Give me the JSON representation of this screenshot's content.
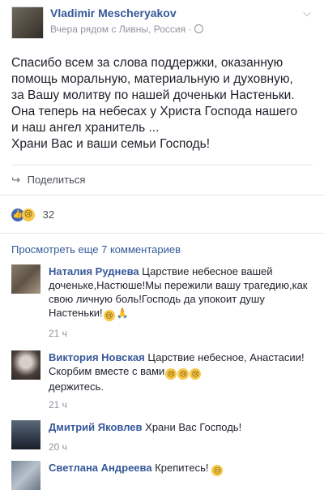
{
  "post": {
    "author": "Vladimir Mescheryakov",
    "meta": "Вчера рядом с Ливны, Россия ·",
    "text": "Спасибо всем за слова поддержки, оказанную\nпомощь моральную, материальную и духовную,\nза Вашу молитву по нашей доченьки Настеньки.\nОна теперь на небесах у Христа Господа нашего\nи наш ангел хранитель ...\nХрани Вас и ваши семьи Господь!",
    "share_label": "Поделиться",
    "reaction_count": "32"
  },
  "comments": {
    "more_label": "Просмотреть еще 7 комментариев",
    "items": [
      {
        "name": "Наталия Руднева",
        "text": " Царствие небесное вашей доченьке,Настюше!Мы пережили вашу трагедию,как свою личную боль!Господь да упокоит душу Настеньки!",
        "time": "21 ч"
      },
      {
        "name": "Виктория Новская",
        "text": " Царствие небесное, Анастасии!Скорбим вместе с вами",
        "text2": "держитесь.",
        "time": "21 ч"
      },
      {
        "name": "Дмитрий Яковлев",
        "text": " Храни Вас Господь!",
        "time": "20 ч"
      },
      {
        "name": "Светлана Андреева",
        "text": " Крепитесь!"
      }
    ]
  },
  "icons": {
    "globe": "globe-icon",
    "chevron": "chevron-down-icon",
    "share": "share-icon",
    "like": "like-reaction-icon",
    "sad": "sad-reaction-icon",
    "cry_emoji": "crying-emoji-icon",
    "praying": "praying-hands-icon",
    "frown_emoji": "frowning-emoji-icon"
  },
  "colors": {
    "link": "#365899",
    "meta": "#90949c",
    "text": "#1d2129",
    "like_blue": "#4267b2",
    "sad_yellow": "#f7c84a"
  }
}
